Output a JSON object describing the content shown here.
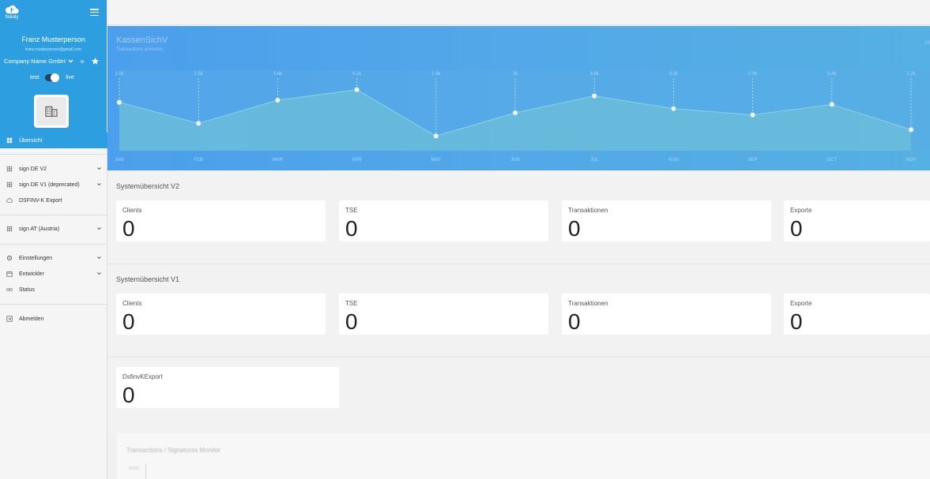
{
  "app": {
    "logo_text": "fiskaly",
    "colors": {
      "brand": "#2d9ee0",
      "sidebar_bg": "#f5f5f5",
      "chart_bg": "#4b9fec"
    }
  },
  "sidebar": {
    "user_name": "Franz Musterperson",
    "user_email": "franz.musterperson@gmail.com",
    "company_name": "Company Name GmbH",
    "env_test": "test",
    "env_live": "live",
    "env_live_on": true,
    "items": [
      {
        "label": "Übersicht",
        "icon": "dashboard-icon",
        "active": true
      },
      {
        "label": "sign DE V2",
        "icon": "grid-icon",
        "expandable": true
      },
      {
        "label": "sign DE V1 (deprecated)",
        "icon": "grid-icon",
        "expandable": true
      },
      {
        "label": "DSFINV-K Export",
        "icon": "cloud-icon"
      },
      {
        "label": "sign AT (Austria)",
        "icon": "grid-icon",
        "expandable": true
      },
      {
        "label": "Einstellungen",
        "icon": "gear-icon",
        "expandable": true
      },
      {
        "label": "Entwickler",
        "icon": "calendar-icon",
        "expandable": true
      },
      {
        "label": "Status",
        "icon": "link-icon"
      },
      {
        "label": "Abmelden",
        "icon": "logout-icon"
      }
    ]
  },
  "chart": {
    "title": "KassenSichV",
    "subtitle": "Transactions amounts",
    "right_label": "20",
    "chart_data": {
      "type": "area",
      "categories": [
        "JAN",
        "FEB",
        "MAR",
        "APR",
        "MAY",
        "JUN",
        "JUL",
        "AUG",
        "SEP",
        "OCT",
        "NOV"
      ],
      "point_labels": [
        "3.5k",
        "2.5k",
        "3.6k",
        "4.1k",
        "1.9k",
        "3k",
        "3.8k",
        "3.2k",
        "2.9k",
        "3.4k",
        "2.2k"
      ],
      "values": [
        3500,
        2500,
        3600,
        4100,
        1900,
        3000,
        3800,
        3200,
        2900,
        3400,
        2200
      ],
      "ylim": [
        1500,
        4500
      ]
    }
  },
  "v2": {
    "title": "Systemübersicht V2",
    "cards": [
      {
        "label": "Clients",
        "value": "0"
      },
      {
        "label": "TSE",
        "value": "0"
      },
      {
        "label": "Transaktionen",
        "value": "0"
      },
      {
        "label": "Exporte",
        "value": "0"
      }
    ]
  },
  "v1": {
    "title": "Systemübersicht V1",
    "cards": [
      {
        "label": "Clients",
        "value": "0"
      },
      {
        "label": "TSE",
        "value": "0"
      },
      {
        "label": "Transaktionen",
        "value": "0"
      },
      {
        "label": "Exporte",
        "value": "0"
      }
    ]
  },
  "dsfinvk": {
    "label": "DsfinvKExport",
    "value": "0"
  },
  "monitor": {
    "title": "Transactions / Signatures Monitor",
    "tick": "5000"
  }
}
